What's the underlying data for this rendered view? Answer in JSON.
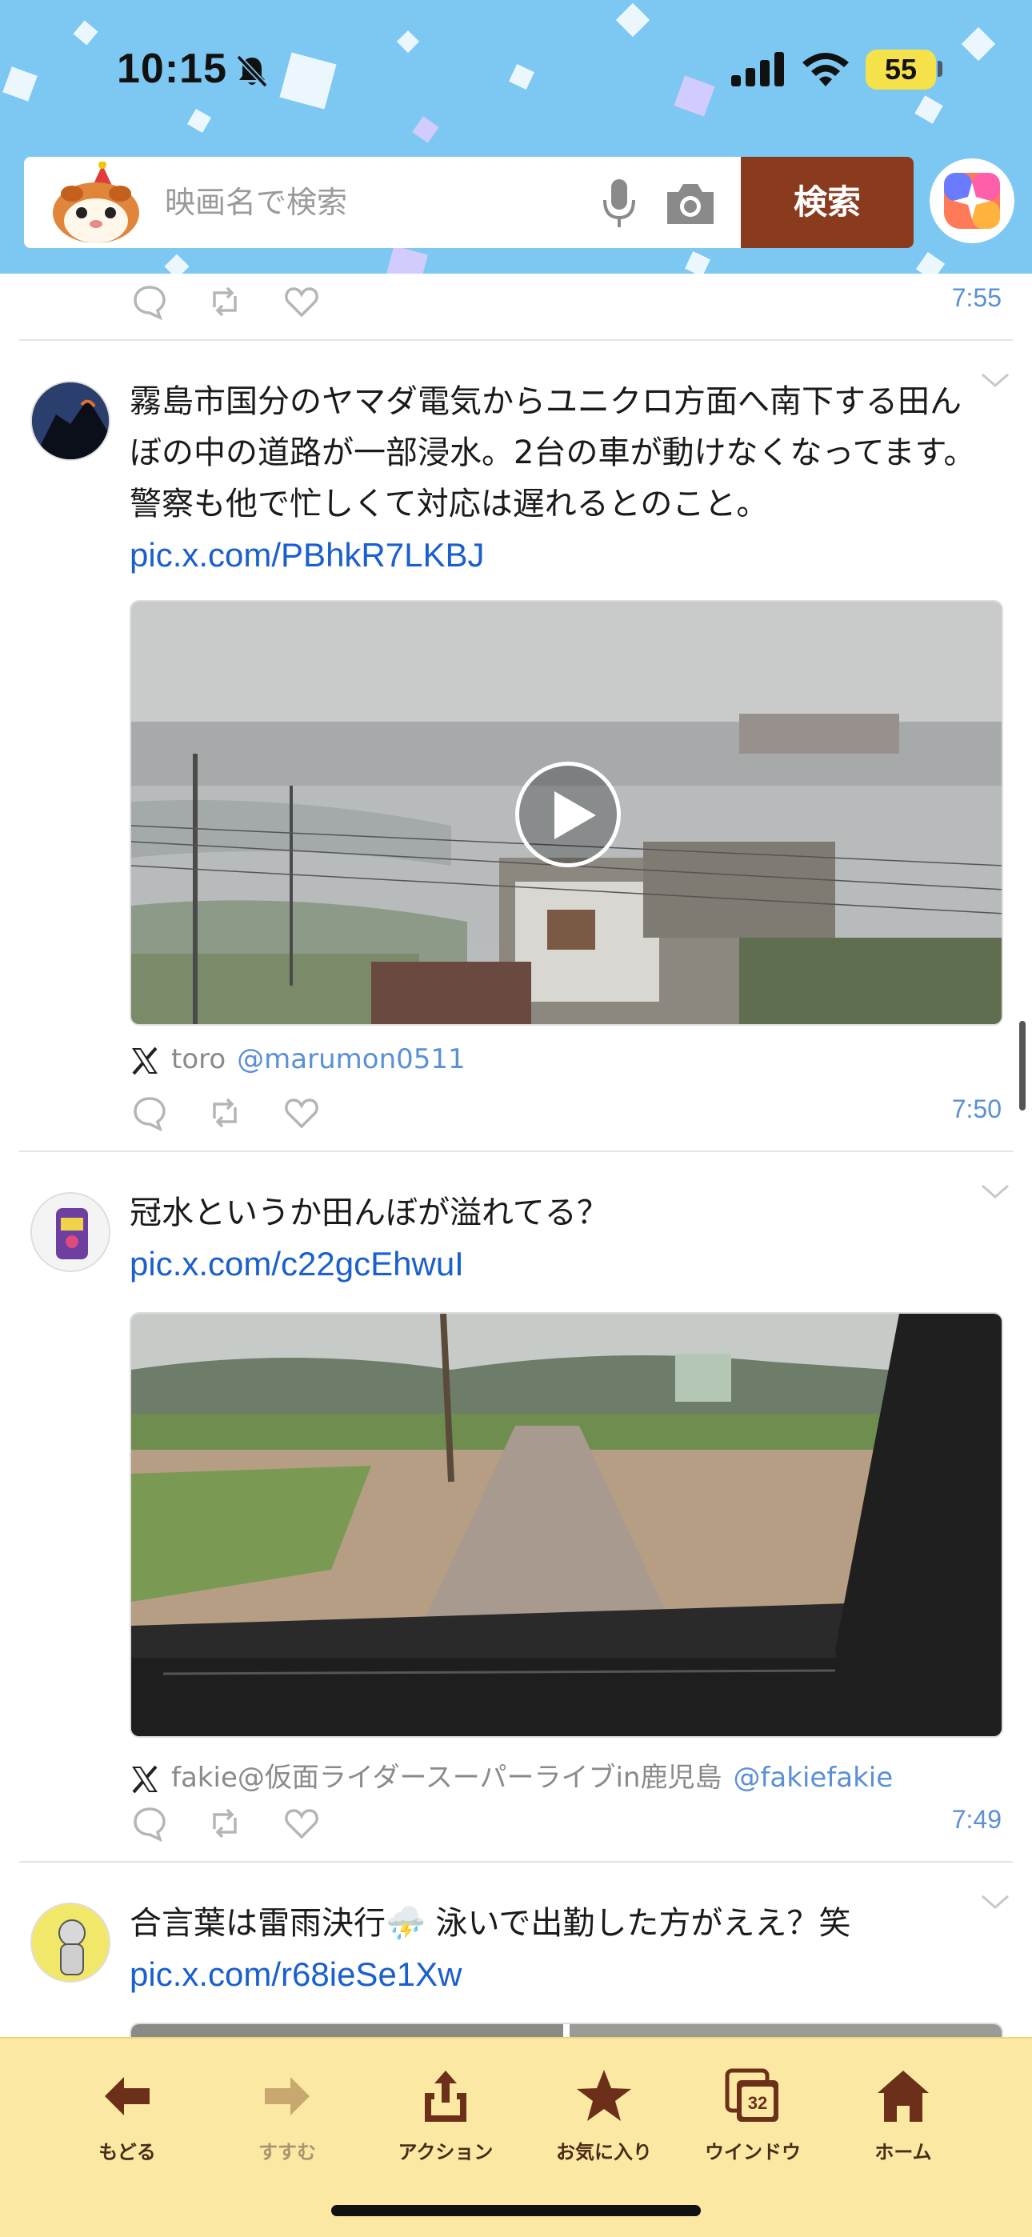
{
  "status_bar": {
    "time": "10:15",
    "battery": "55",
    "icons": [
      "bell-slash-icon",
      "cellular-signal-icon",
      "wifi-icon",
      "battery-icon"
    ]
  },
  "search": {
    "placeholder": "映画名で検索",
    "button_label": "検索",
    "icons": [
      "mascot-icon",
      "microphone-icon",
      "camera-icon",
      "app-badge-icon"
    ]
  },
  "timeline": {
    "top_timestamp": "7:55",
    "tweets": [
      {
        "text": "霧島市国分のヤマダ電気からユニクロ方面へ南下する田んぼの中の道路が一部浸水。2台の車が動けなくなってます。警察も他で忙しくて対応は遅れるとのこと。",
        "link": "pic.x.com/PBhkR7LKBJ",
        "media_type": "video",
        "author_name": "toro",
        "author_handle": "@marumon0511",
        "timestamp": "7:50"
      },
      {
        "text": "冠水というか田んぼが溢れてる？",
        "link": "pic.x.com/c22gcEhwuI",
        "media_type": "photo",
        "author_name": "fakie@仮面ライダースーパーライブin鹿児島",
        "author_handle": "@fakiefakie",
        "timestamp": "7:49"
      },
      {
        "text": "合言葉は雷雨決行⛈️ 泳いで出勤した方がええ？笑",
        "link": "pic.x.com/r68ieSe1Xw",
        "media_type": "photo"
      }
    ]
  },
  "toolbar": {
    "items": [
      {
        "label": "もどる",
        "icon": "arrow-left-icon"
      },
      {
        "label": "すすむ",
        "icon": "arrow-right-icon"
      },
      {
        "label": "アクション",
        "icon": "share-icon"
      },
      {
        "label": "お気に入り",
        "icon": "star-icon"
      },
      {
        "label": "ウインドウ",
        "icon": "windows-icon",
        "badge": "32"
      },
      {
        "label": "ホーム",
        "icon": "home-icon"
      }
    ]
  },
  "colors": {
    "header_bg": "#7cc8f2",
    "search_button": "#8a3a1d",
    "link": "#1a5fcf",
    "timestamp": "#5b8fd6",
    "toolbar_bg": "#fbe8a2",
    "battery": "#f5e14a"
  }
}
